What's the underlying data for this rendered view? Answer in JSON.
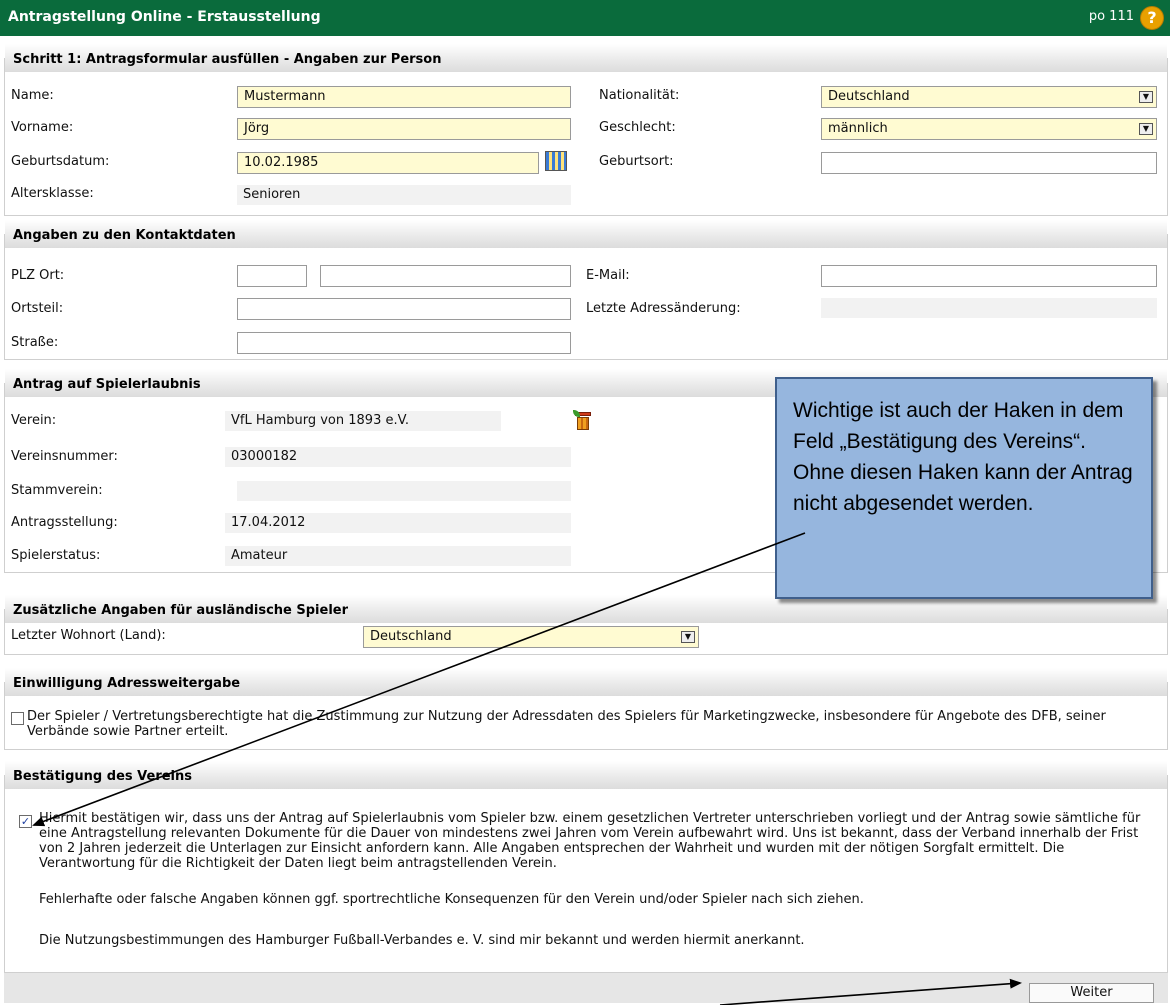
{
  "header": {
    "title": "Antragstellung Online - Erstausstellung",
    "code": "po 111",
    "help_icon": "?"
  },
  "person": {
    "title": "Schritt 1: Antragsformular ausfüllen - Angaben zur Person",
    "name_label": "Name:",
    "name_value": "Mustermann",
    "vorname_label": "Vorname:",
    "vorname_value": "Jörg",
    "geburtsdatum_label": "Geburtsdatum:",
    "geburtsdatum_value": "10.02.1985",
    "altersklasse_label": "Altersklasse:",
    "altersklasse_value": "Senioren",
    "nationalitaet_label": "Nationalität:",
    "nationalitaet_value": "Deutschland",
    "geschlecht_label": "Geschlecht:",
    "geschlecht_value": "männlich",
    "geburtsort_label": "Geburtsort:",
    "geburtsort_value": ""
  },
  "contact": {
    "title": "Angaben zu den Kontaktdaten",
    "plz_label": "PLZ Ort:",
    "plz_value": "",
    "ort_value": "",
    "ortsteil_label": "Ortsteil:",
    "ortsteil_value": "",
    "strasse_label": "Straße:",
    "strasse_value": "",
    "email_label": "E-Mail:",
    "email_value": "",
    "letzte_label": "Letzte Adressänderung:",
    "letzte_value": ""
  },
  "antrag": {
    "title": "Antrag auf Spielerlaubnis",
    "verein_label": "Verein:",
    "verein_value": "VfL Hamburg von 1893 e.V.",
    "vereinsnummer_label": "Vereinsnummer:",
    "vereinsnummer_value": "03000182",
    "stammverein_label": "Stammverein:",
    "stammverein_value": "",
    "antragsstellung_label": "Antragsstellung:",
    "antragsstellung_value": "17.04.2012",
    "spielerstatus_label": "Spielerstatus:",
    "spielerstatus_value": "Amateur"
  },
  "auslaender": {
    "title": "Zusätzliche Angaben für ausländische Spieler",
    "wohnort_label": "Letzter Wohnort (Land):",
    "wohnort_value": "Deutschland"
  },
  "einwilligung": {
    "title": "Einwilligung Adressweitergabe",
    "checked": false,
    "text": "Der Spieler / Vertretungsberechtigte hat die Zustimmung zur Nutzung der Adressdaten des Spielers für Marketingzwecke, insbesondere für Angebote des DFB, seiner Verbände sowie Partner erteilt."
  },
  "bestaetigung": {
    "title": "Bestätigung des Vereins",
    "checked": true,
    "text1": "Hiermit bestätigen wir, dass uns der Antrag auf Spielerlaubnis vom Spieler bzw. einem gesetzlichen Vertreter unterschrieben vorliegt und der Antrag sowie sämtliche für eine Antragstellung relevanten Dokumente für die Dauer von mindestens zwei Jahren vom Verein aufbewahrt wird. Uns ist bekannt, dass der Verband innerhalb der Frist von 2 Jahren jederzeit die Unterlagen zur Einsicht anfordern kann. Alle Angaben entsprechen der Wahrheit und wurden mit der nötigen Sorgfalt ermittelt. Die Verantwortung für die Richtigkeit der Daten liegt beim antragstellenden Verein.",
    "text2": "Fehlerhafte oder falsche Angaben können ggf. sportrechtliche Konsequenzen für den Verein und/oder Spieler nach sich ziehen.",
    "text3": "Die Nutzungsbestimmungen des Hamburger Fußball-Verbandes e. V. sind mir bekannt und werden hiermit anerkannt."
  },
  "callout": {
    "text": "Wichtige ist auch der Haken in dem Feld „Bestätigung des Vereins“. Ohne diesen Haken kann der Antrag nicht abgesendet werden."
  },
  "footer": {
    "weiter_label": "Weiter"
  },
  "icons": {
    "checkmark": "✓",
    "dropdown": "▼"
  },
  "colors": {
    "header_bg": "#0a6b3c",
    "required_field": "#fffbd2",
    "callout_bg": "#96b6de"
  }
}
